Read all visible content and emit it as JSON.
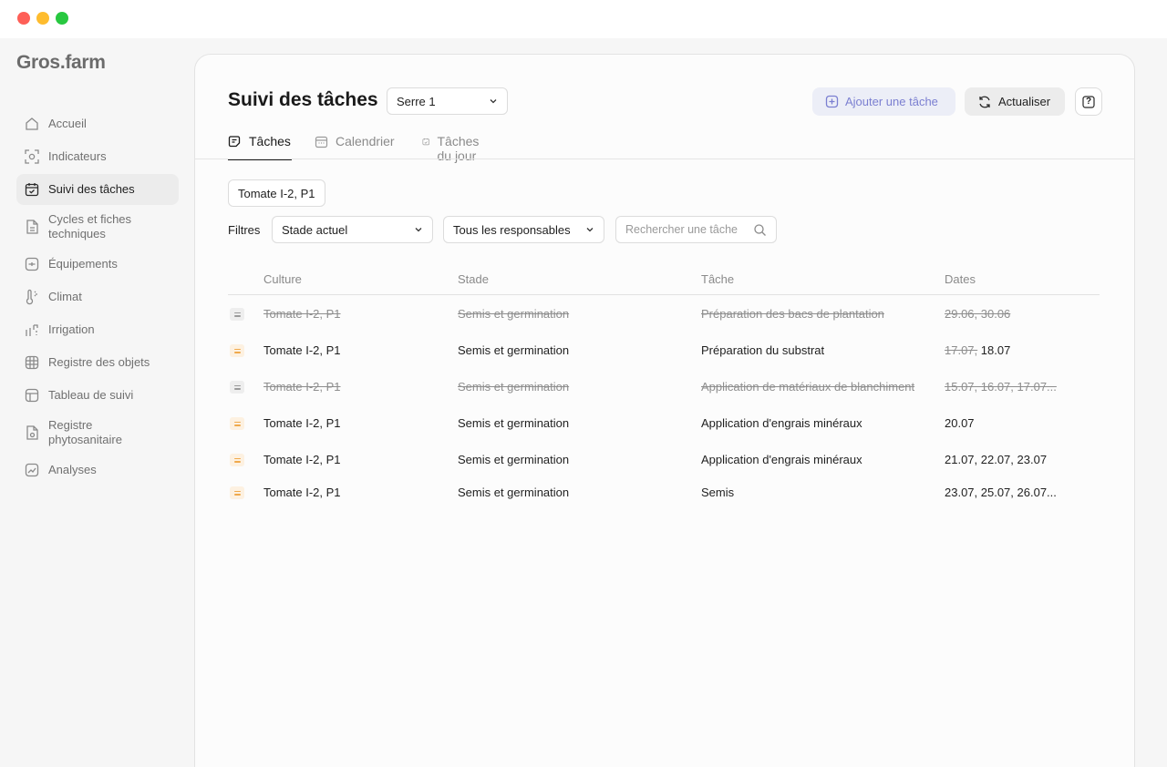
{
  "app": {
    "logo": "Gros.farm"
  },
  "sidebar": {
    "items": [
      {
        "label": "Accueil",
        "icon": "home-icon"
      },
      {
        "label": "Indicateurs",
        "icon": "indicator-icon"
      },
      {
        "label": "Suivi des tâches",
        "icon": "task-calendar-icon",
        "active": true
      },
      {
        "label": "Cycles et fiches techniques",
        "icon": "document-icon"
      },
      {
        "label": "Équipements",
        "icon": "equipment-icon"
      },
      {
        "label": "Climat",
        "icon": "thermometer-icon"
      },
      {
        "label": "Irrigation",
        "icon": "irrigation-icon"
      },
      {
        "label": "Registre des objets",
        "icon": "grid-icon"
      },
      {
        "label": "Tableau de suivi",
        "icon": "table-icon"
      },
      {
        "label": "Registre phytosanitaire",
        "icon": "phyto-document-icon"
      },
      {
        "label": "Analyses",
        "icon": "chart-icon"
      }
    ]
  },
  "header": {
    "title": "Suivi des tâches",
    "greenhouse_select": "Serre 1",
    "add_task_label": "Ajouter une tâche",
    "refresh_label": "Actualiser",
    "help_label": "?"
  },
  "tabs": [
    {
      "label": "Tâches",
      "active": true
    },
    {
      "label": "Calendrier"
    },
    {
      "label": "Tâches du jour"
    }
  ],
  "selected_chip": "Tomate I-2, P1",
  "filters": {
    "label": "Filtres",
    "stage_select": "Stade actuel",
    "owner_select": "Tous les responsables",
    "search_placeholder": "Rechercher une tâche"
  },
  "table": {
    "columns": [
      "Culture",
      "Stade",
      "Tâche",
      "Dates"
    ],
    "rows": [
      {
        "culture": "Tomate I-2, P1",
        "stage": "Semis et germination",
        "task": "Préparation des bacs de plantation",
        "dates_done": "29.06, 30.06",
        "dates_pending": "",
        "done": true
      },
      {
        "culture": "Tomate I-2, P1",
        "stage": "Semis et germination",
        "task": "Préparation du substrat",
        "dates_done": "17.07,",
        "dates_pending": "18.07",
        "done": false
      },
      {
        "culture": "Tomate I-2, P1",
        "stage": "Semis et germination",
        "task": "Application de matériaux de blanchiment",
        "dates_done": "15.07, 16.07, 17.07...",
        "dates_pending": "",
        "done": true
      },
      {
        "culture": "Tomate I-2, P1",
        "stage": "Semis et germination",
        "task": "Application d'engrais minéraux",
        "dates_done": "",
        "dates_pending": "20.07",
        "done": false
      },
      {
        "culture": "Tomate I-2, P1",
        "stage": "Semis et germination",
        "task": "Application d'engrais minéraux",
        "dates_done": "",
        "dates_pending": "21.07, 22.07, 23.07",
        "done": false
      },
      {
        "culture": "Tomate I-2, P1",
        "stage": "Semis et germination",
        "task": "Semis",
        "dates_done": "",
        "dates_pending": "23.07, 25.07, 26.07...",
        "done": false
      }
    ]
  },
  "colors": {
    "accent": "#7b7fd1",
    "pending_icon": "#f0a94b",
    "done_icon": "#9a9a9a"
  }
}
